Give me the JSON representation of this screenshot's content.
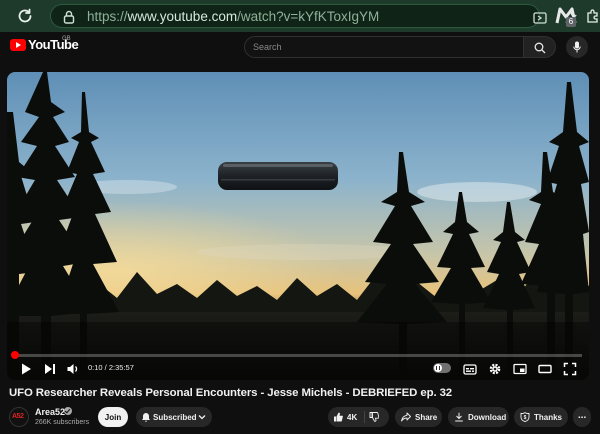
{
  "browser": {
    "url_prefix": "https://",
    "url_host": "www.youtube.com",
    "url_path": "/watch?v=kYfKToxIgYM",
    "extension_badge": "6"
  },
  "header": {
    "logo_text": "YouTube",
    "country_code": "GB",
    "search_placeholder": "Search"
  },
  "player": {
    "progress_fraction": 0.0011,
    "time_current": "0:10",
    "time_total": "2:35:57",
    "time_display": "0:10 / 2:35:57"
  },
  "video": {
    "title": "UFO Researcher Reveals Personal Encounters - Jesse Michels - DEBRIEFED ep. 32"
  },
  "channel": {
    "name": "Area52",
    "avatar_text": "A52",
    "subscribers": "266K subscribers"
  },
  "actions": {
    "join": "Join",
    "subscribed": "Subscribed",
    "likes": "4K",
    "share": "Share",
    "download": "Download",
    "thanks": "Thanks",
    "more": "⋯"
  },
  "colors": {
    "browser_bar": "#1e3a2a",
    "youtube_red": "#ff0000",
    "background": "#0f0f0f"
  }
}
